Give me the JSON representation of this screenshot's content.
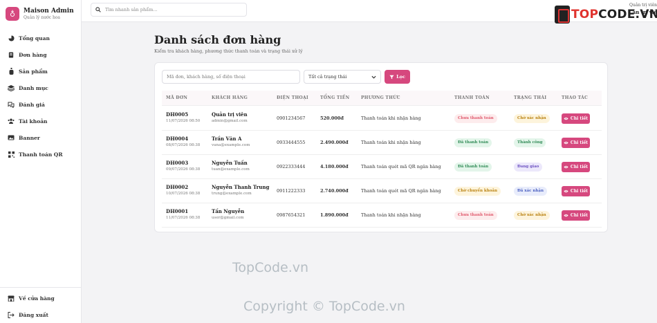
{
  "brand": {
    "title": "Maison Admin",
    "subtitle": "Quản lý nước hoa"
  },
  "sidebar": {
    "items": [
      {
        "label": "Tổng quan",
        "icon": "pie-chart-icon"
      },
      {
        "label": "Đơn hàng",
        "icon": "receipt-icon"
      },
      {
        "label": "Sản phẩm",
        "icon": "perfume-bottle-icon"
      },
      {
        "label": "Danh mục",
        "icon": "layers-icon"
      },
      {
        "label": "Đánh giá",
        "icon": "comments-icon"
      },
      {
        "label": "Tài khoản",
        "icon": "users-icon"
      },
      {
        "label": "Banner",
        "icon": "image-icon"
      },
      {
        "label": "Thanh toán QR",
        "icon": "qr-code-icon"
      }
    ],
    "bottom": [
      {
        "label": "Về cửa hàng",
        "icon": "store-icon"
      },
      {
        "label": "Đăng xuất",
        "icon": "logout-icon"
      }
    ]
  },
  "topbar": {
    "search_placeholder": "Tìm nhanh sản phẩm...",
    "user_role": "Quản trị viên",
    "user_name": "ản trị viê"
  },
  "watermark": {
    "logo_prefix": "TOP",
    "logo_suffix": "CODE.VN",
    "text1": "TopCode.vn",
    "text2": "Copyright © TopCode.vn"
  },
  "page": {
    "title": "Danh sách đơn hàng",
    "subtitle": "Kiểm tra khách hàng, phương thức thanh toán và trạng thái xử lý"
  },
  "filters": {
    "search_placeholder": "Mã đơn, khách hàng, số điện thoại",
    "status_selected": "Tất cả trạng thái",
    "filter_button": "Lọc"
  },
  "table": {
    "headers": [
      "MÃ ĐƠN",
      "KHÁCH HÀNG",
      "ĐIỆN THOẠI",
      "TỔNG TIỀN",
      "PHƯƠNG THỨC",
      "THANH TOÁN",
      "TRẠNG THÁI",
      "THAO TÁC"
    ],
    "detail_label": "Chi tiết",
    "rows": [
      {
        "code": "DH0005",
        "date": "11/07/2026 08:50",
        "name": "Quản trị viên",
        "email": "admin@gmail.com",
        "phone": "0901234567",
        "total": "520.000đ",
        "method": "Thanh toán khi nhận hàng",
        "payment": "Chưa thanh toán",
        "payment_color": "#e05a6d",
        "payment_bg": "#fdeced",
        "status": "Chờ xác nhận",
        "status_color": "#b9810f",
        "status_bg": "#fdf4dc"
      },
      {
        "code": "DH0004",
        "date": "08/07/2026 08:38",
        "name": "Trần Văn A",
        "email": "vana@example.com",
        "phone": "0933444555",
        "total": "2.490.000đ",
        "method": "Thanh toán khi nhận hàng",
        "payment": "Đã thanh toán",
        "payment_color": "#2f8a55",
        "payment_bg": "#e3f5ea",
        "status": "Thành công",
        "status_color": "#2f8a55",
        "status_bg": "#e3f5ea"
      },
      {
        "code": "DH0003",
        "date": "09/07/2026 08:38",
        "name": "Nguyễn Tuấn",
        "email": "tuan@example.com",
        "phone": "0922333444",
        "total": "4.180.000đ",
        "method": "Thanh toán quét mã QR ngân hàng",
        "payment": "Đã thanh toán",
        "payment_color": "#2f8a55",
        "payment_bg": "#e3f5ea",
        "status": "Đang giao",
        "status_color": "#6a4fc0",
        "status_bg": "#ece8fb"
      },
      {
        "code": "DH0002",
        "date": "10/07/2026 08:38",
        "name": "Nguyễn Thanh Trung",
        "email": "trung@example.com",
        "phone": "0911222333",
        "total": "2.740.000đ",
        "method": "Thanh toán quét mã QR ngân hàng",
        "payment": "Chờ chuyển khoản",
        "payment_color": "#b9810f",
        "payment_bg": "#fdf4dc",
        "status": "Đã xác nhận",
        "status_color": "#4a5fc0",
        "status_bg": "#e8ecfb"
      },
      {
        "code": "DH0001",
        "date": "11/07/2026 08:38",
        "name": "Tấn Nguyễn",
        "email": "user@gmail.com",
        "phone": "0987654321",
        "total": "1.890.000đ",
        "method": "Thanh toán khi nhận hàng",
        "payment": "Chưa thanh toán",
        "payment_color": "#e05a6d",
        "payment_bg": "#fdeced",
        "status": "Chờ xác nhận",
        "status_color": "#b9810f",
        "status_bg": "#fdf4dc"
      }
    ]
  },
  "colors": {
    "accent": "#d6487e"
  }
}
